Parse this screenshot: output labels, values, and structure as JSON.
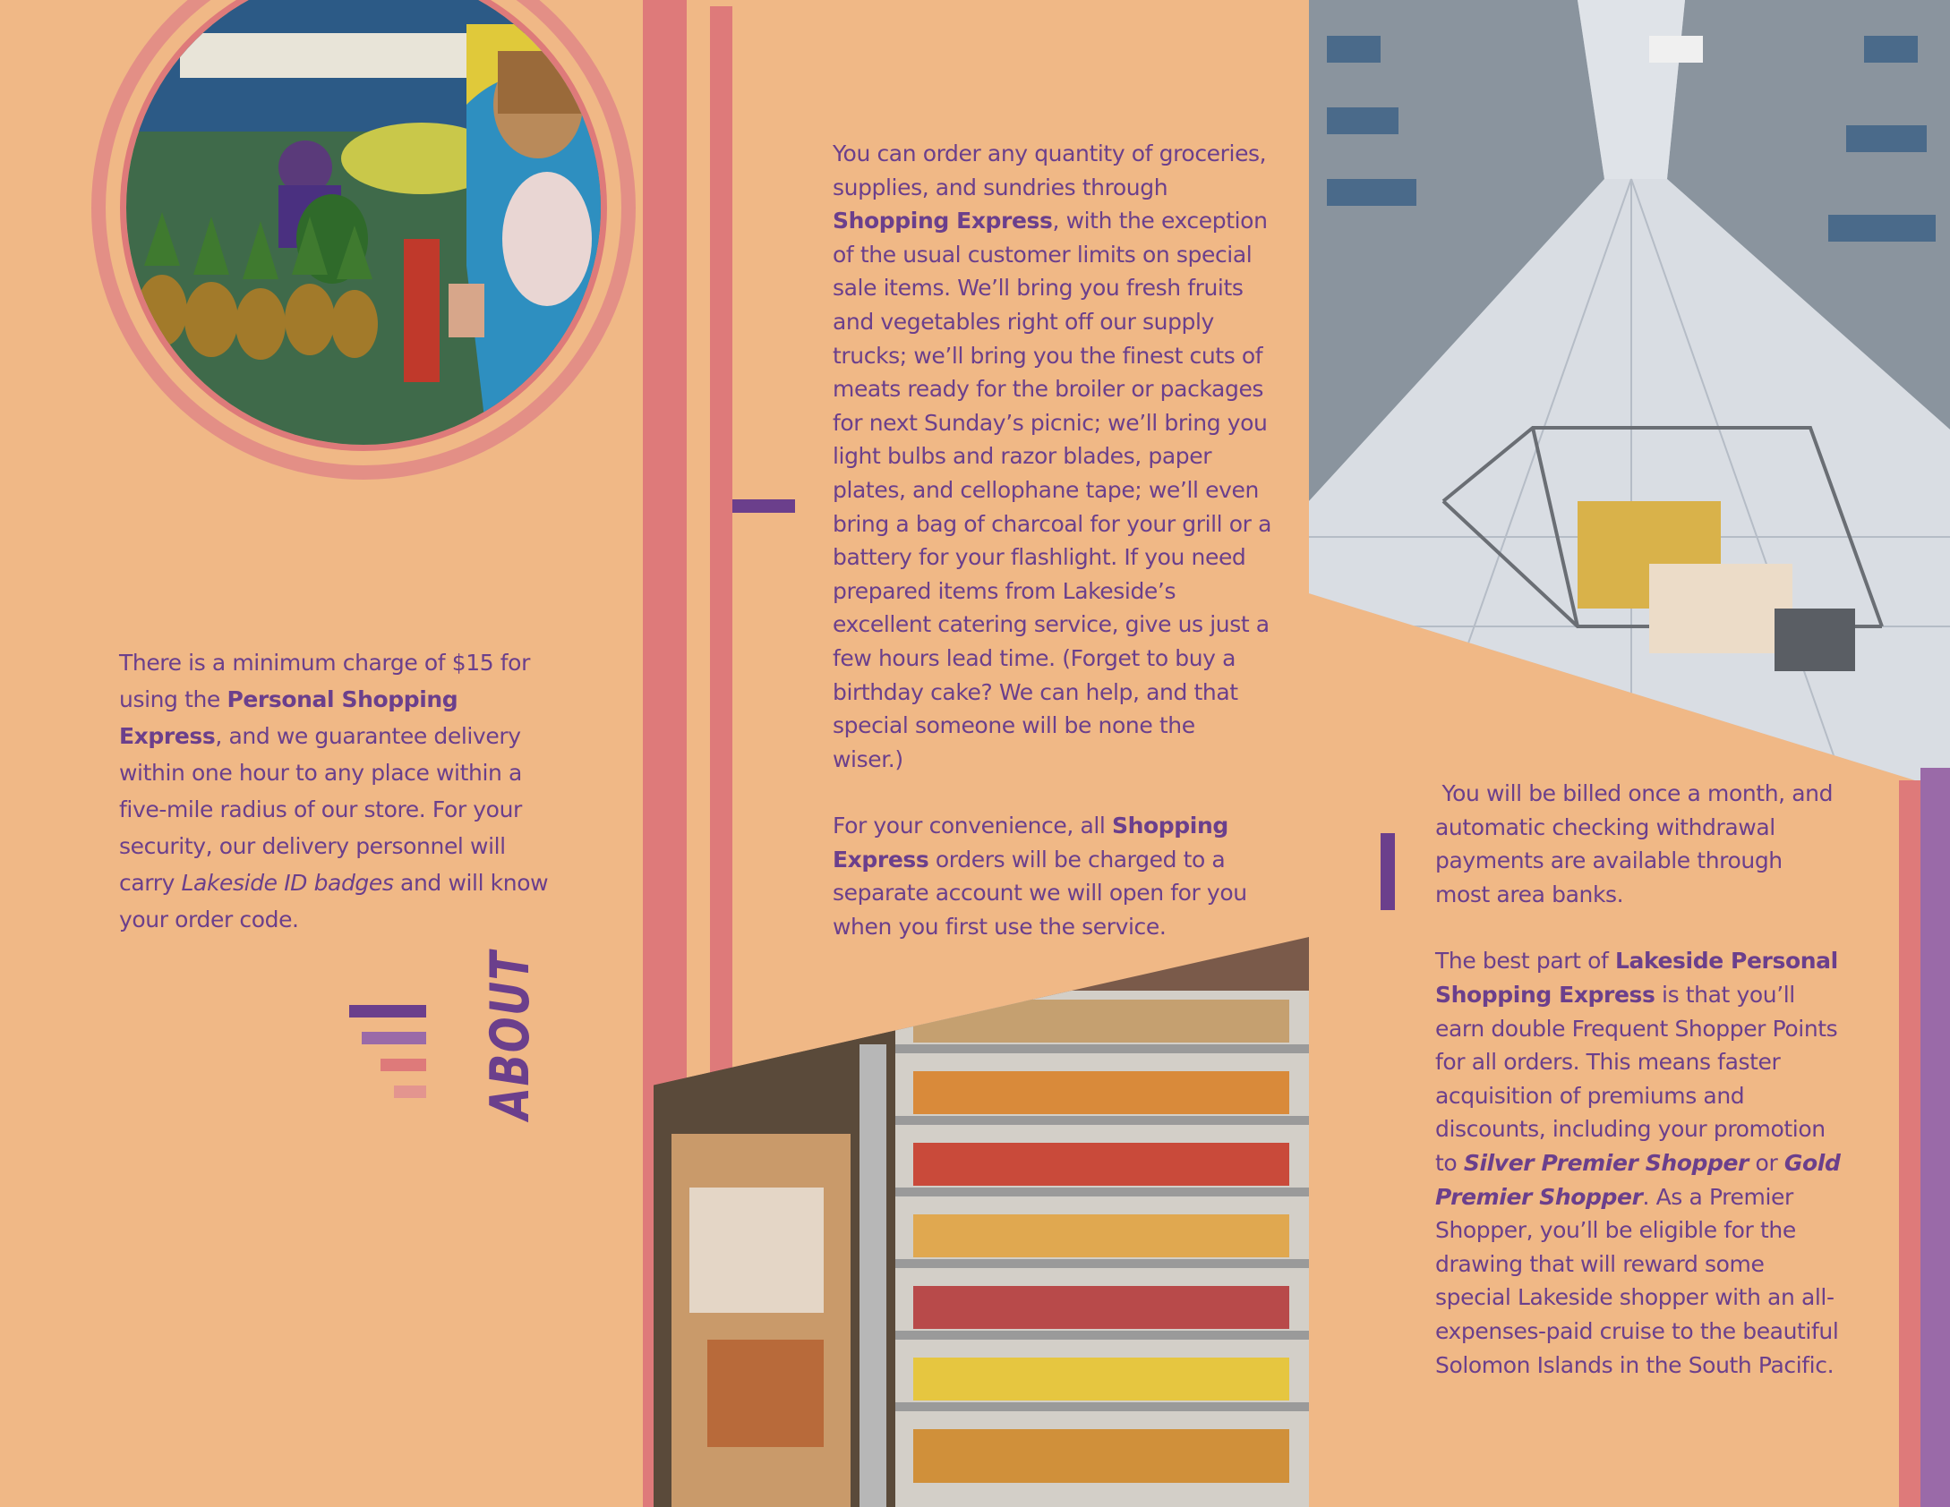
{
  "colors": {
    "background": "#f0b886",
    "text_purple": "#6b3f8c",
    "accent_pink": "#de7a7a",
    "accent_purple": "#9a6aa8"
  },
  "left_panel": {
    "photo_alt": "",
    "paragraph": {
      "p1": "There is a minimum charge of $15 for using the ",
      "b1": "Personal Shopping Express",
      "p2": ", and we guarantee delivery within one hour to any place within a five-mile radius of our store.  For your security, our delivery personnel will carry ",
      "i1": "Lakeside ID badges",
      "p3": " and will know your order code."
    },
    "heading": "ABOUT"
  },
  "middle_panel": {
    "para1": {
      "t1": "You can order any quantity of groceries, supplies, and sundries through ",
      "b1": "Shopping Express",
      "t2": ", with the exception of the usual customer limits on special sale items.  We’ll bring you fresh fruits and vegetables right off our supply trucks; we’ll bring you the finest cuts of meats ready for the broiler or packages for next Sunday’s picnic; we’ll bring you light bulbs and razor blades, paper plates, and cellophane tape; we’ll even bring a bag of charcoal for your grill or a battery for your flashlight.  If you need prepared items from Lakeside’s excellent catering service, give us just a few hours lead time.  (Forget to buy a birthday cake? We can help, and that special someone will be none the wiser.)"
    },
    "para2": {
      "t1": "For your convenience, all ",
      "b1": "Shopping Express",
      "t2": " orders will be charged to a separate account we will open for you when you first use the service."
    }
  },
  "right_panel": {
    "para1": " You will be billed once a month, and automatic checking withdrawal payments are available through most area banks.",
    "para2": {
      "t1": "The best part of ",
      "b1": "Lakeside Personal Shopping Express",
      "t2": " is that you’ll earn double Frequent Shopper Points for all orders.  This means faster acquisition of premiums and discounts, including your promotion to ",
      "bi1": "Silver Premier Shopper",
      "t3": " or ",
      "bi2": "Gold Premier Shopper",
      "t4": ".  As a Premier Shopper, you’ll be eligible for the drawing that will reward some special Lakeside shopper with an all-expenses-paid cruise to the beautiful Solomon Islands in the South Pacific."
    }
  }
}
